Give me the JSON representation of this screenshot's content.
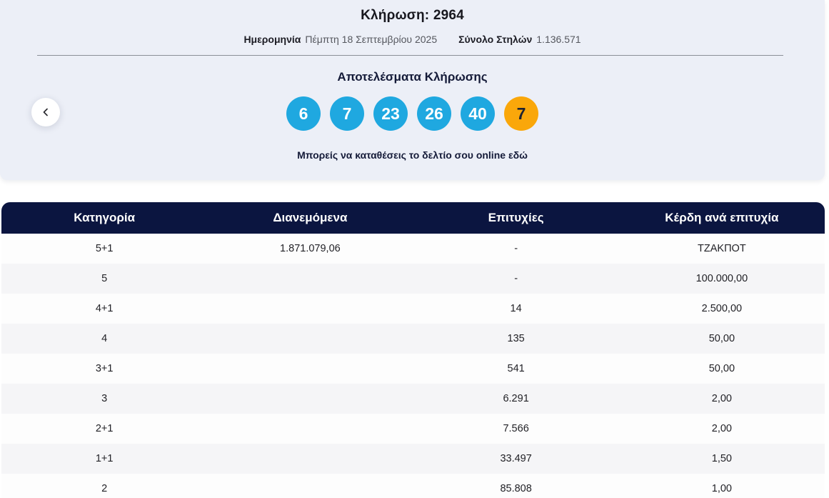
{
  "hero": {
    "title": "Κλήρωση: 2964",
    "date_label": "Ημερομηνία",
    "date_value": "Πέμπτη 18 Σεπτεμβρίου 2025",
    "columns_label": "Σύνολο Στηλών",
    "columns_value": "1.136.571",
    "results_heading": "Αποτελέσματα Κλήρωσης",
    "deposit_text": "Μπορείς να καταθέσεις το δελτίο σου online",
    "deposit_link_text": "εδώ"
  },
  "draw": {
    "numbers": [
      "6",
      "7",
      "23",
      "26",
      "40"
    ],
    "joker": "7",
    "number_ball_color": "#1fa8e0",
    "joker_ball_color": "#faa70a"
  },
  "table": {
    "headers": [
      "Κατηγορία",
      "Διανεμόμενα",
      "Επιτυχίες",
      "Κέρδη ανά επιτυχία"
    ],
    "header_bg_color": "#0b1540",
    "rows": [
      {
        "category": "5+1",
        "distributed": "1.871.079,06",
        "winners": "-",
        "prize": "ΤΖΑΚΠΟΤ"
      },
      {
        "category": "5",
        "distributed": "",
        "winners": "-",
        "prize": "100.000,00"
      },
      {
        "category": "4+1",
        "distributed": "",
        "winners": "14",
        "prize": "2.500,00"
      },
      {
        "category": "4",
        "distributed": "",
        "winners": "135",
        "prize": "50,00"
      },
      {
        "category": "3+1",
        "distributed": "",
        "winners": "541",
        "prize": "50,00"
      },
      {
        "category": "3",
        "distributed": "",
        "winners": "6.291",
        "prize": "2,00"
      },
      {
        "category": "2+1",
        "distributed": "",
        "winners": "7.566",
        "prize": "2,00"
      },
      {
        "category": "1+1",
        "distributed": "",
        "winners": "33.497",
        "prize": "1,50"
      },
      {
        "category": "2",
        "distributed": "",
        "winners": "85.808",
        "prize": "1,00"
      }
    ]
  }
}
